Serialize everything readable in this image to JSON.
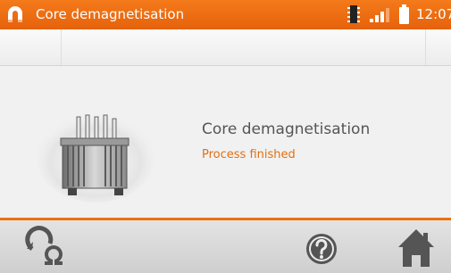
{
  "status_bar": {
    "app_title": "Core demagnetisation",
    "time": "12:07",
    "accent_color": "#e8730e"
  },
  "main": {
    "heading": "Core demagnetisation",
    "status": "Process finished",
    "status_color": "#e16f12",
    "illustration": "transformer-image"
  },
  "bottom_bar": {
    "buttons": [
      {
        "icon": "resistance-icon"
      },
      {
        "icon": "help-icon"
      },
      {
        "icon": "home-icon"
      }
    ]
  }
}
